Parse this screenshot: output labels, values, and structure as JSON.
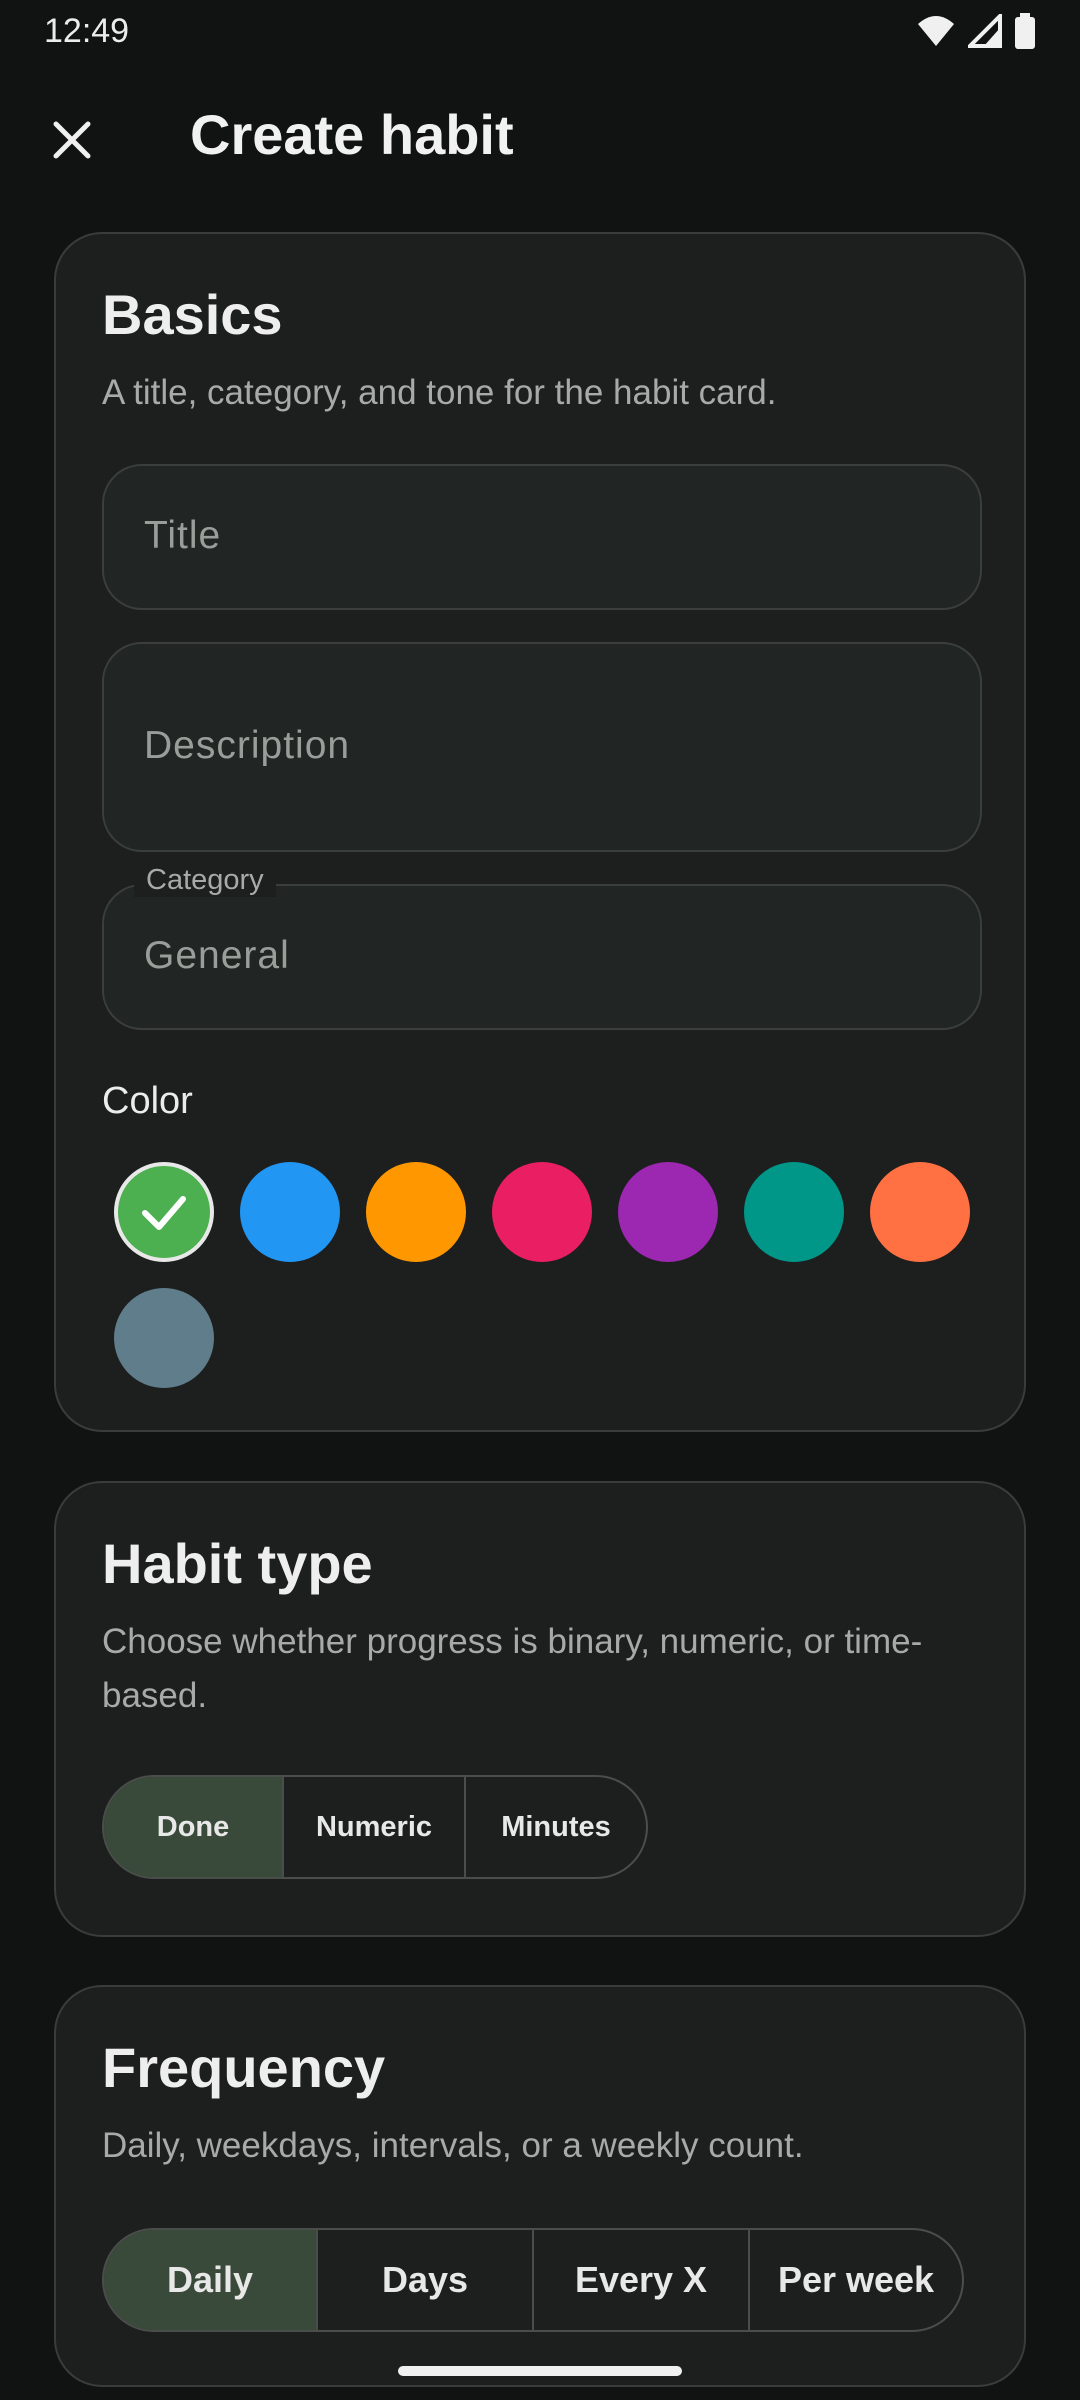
{
  "status_bar": {
    "time": "12:49",
    "icons": [
      "wifi-icon",
      "signal-icon",
      "battery-icon"
    ]
  },
  "app_bar": {
    "title": "Create habit",
    "close_icon": "close-icon"
  },
  "basics": {
    "title": "Basics",
    "subtitle": "A title, category, and tone for the habit card.",
    "title_field": {
      "placeholder": "Title",
      "value": ""
    },
    "description_field": {
      "placeholder": "Description",
      "value": ""
    },
    "category_field": {
      "label": "Category",
      "value": "General"
    },
    "color_label": "Color",
    "colors": [
      "#4caf50",
      "#2196f3",
      "#ff9800",
      "#e91e63",
      "#9c27b0",
      "#009688",
      "#ff7043",
      "#607d8b"
    ],
    "selected_color": "#4caf50"
  },
  "habit_type": {
    "title": "Habit type",
    "subtitle": "Choose whether progress is binary, numeric, or time-based.",
    "options": [
      "Done",
      "Numeric",
      "Minutes"
    ],
    "selected": "Done"
  },
  "frequency": {
    "title": "Frequency",
    "subtitle": "Daily, weekdays, intervals, or a weekly count.",
    "options": [
      "Daily",
      "Days",
      "Every X",
      "Per week"
    ],
    "selected": "Daily"
  }
}
